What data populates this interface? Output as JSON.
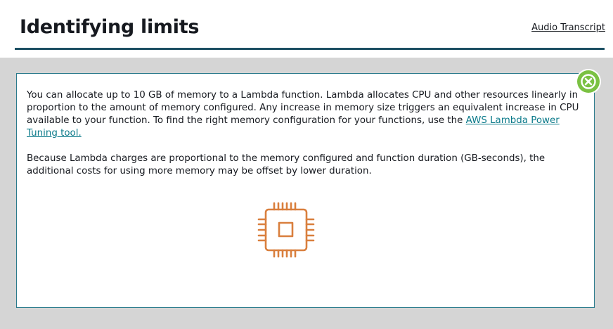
{
  "header": {
    "title": "Identifying limits",
    "audio_transcript_label": "Audio Transcript"
  },
  "panel": {
    "paragraph1_text": "You can allocate up to 10 GB of memory to a Lambda function. Lambda allocates CPU and other resources linearly in proportion to the amount of memory configured. Any increase in memory size triggers an equivalent increase in CPU available to your function. To find the right memory configuration for your functions, use the ",
    "paragraph1_link": "AWS Lambda Power Tuning tool.",
    "paragraph2": "Because Lambda charges are proportional to the memory configured and function duration (GB-seconds), the additional costs for using more memory may be offset by lower duration.",
    "illustration_icon": "cpu-chip-icon",
    "close_icon": "close-icon"
  },
  "colors": {
    "title_rule": "#1c4f63",
    "panel_border": "#2a7a8c",
    "link": "#0b7a8a",
    "close_button": "#7ac142",
    "chip_icon": "#d97f3d",
    "backdrop": "#d5d5d5"
  }
}
